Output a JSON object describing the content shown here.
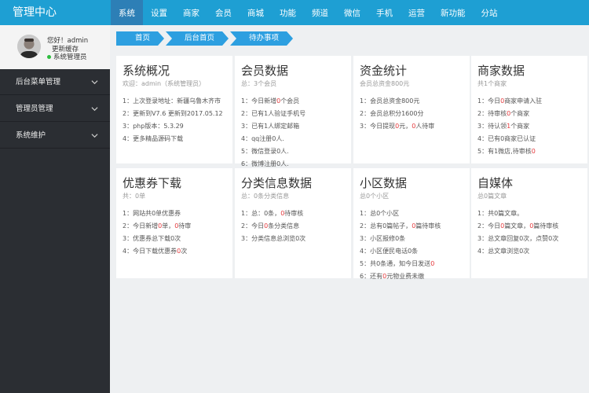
{
  "brand": "管理中心",
  "nav": [
    "系统",
    "设置",
    "商家",
    "会员",
    "商城",
    "功能",
    "频道",
    "微信",
    "手机",
    "运营",
    "新功能",
    "分站"
  ],
  "user": {
    "greeting": "您好！admin",
    "refresh_cache": "更新缓存",
    "role": "系统管理员"
  },
  "sidebar": {
    "items": [
      {
        "label": "后台菜单管理"
      },
      {
        "label": "管理员管理"
      },
      {
        "label": "系统维护"
      }
    ]
  },
  "breadcrumb": [
    "首页",
    "后台首页",
    "待办事项"
  ],
  "cards": [
    {
      "title": "系统概况",
      "subtitle": "欢迎：admin（系统管理员）",
      "lines": [
        [
          {
            "t": "1：上次登录地址：新疆乌鲁木齐市"
          }
        ],
        [
          {
            "t": "2：更新到V7.6 更新到2017.05.12"
          }
        ],
        [
          {
            "t": "3：php版本：5.3.29"
          }
        ],
        [
          {
            "t": "4：更多精品源码下载"
          }
        ]
      ]
    },
    {
      "title": "会员数据",
      "subtitle": "总：3个会员",
      "lines": [
        [
          {
            "t": "1：今日新增"
          },
          {
            "t": "0",
            "r": true
          },
          {
            "t": "个会员"
          }
        ],
        [
          {
            "t": "2：已有1人验证手机号"
          }
        ],
        [
          {
            "t": "3：已有1人绑定邮箱"
          }
        ],
        [
          {
            "t": "4：qq注册0人."
          }
        ],
        [
          {
            "t": "5：微信登录0人."
          }
        ],
        [
          {
            "t": "6：微博注册0人."
          }
        ]
      ]
    },
    {
      "title": "资金统计",
      "subtitle": "会员总资金800元",
      "lines": [
        [
          {
            "t": "1：会员总资金800元"
          }
        ],
        [
          {
            "t": "2：会员总积分1600分"
          }
        ],
        [
          {
            "t": "3：今日提现"
          },
          {
            "t": "0",
            "r": true
          },
          {
            "t": "元，"
          },
          {
            "t": "0",
            "r": true
          },
          {
            "t": "人待审"
          }
        ]
      ]
    },
    {
      "title": "商家数据",
      "subtitle": "共1个商家",
      "lines": [
        [
          {
            "t": "1：今日"
          },
          {
            "t": "0",
            "r": true
          },
          {
            "t": "商家申请入驻"
          }
        ],
        [
          {
            "t": "2：待审核"
          },
          {
            "t": "0",
            "r": true
          },
          {
            "t": "个商家"
          }
        ],
        [
          {
            "t": "3：待认领"
          },
          {
            "t": "1",
            "r": true
          },
          {
            "t": "个商家"
          }
        ],
        [
          {
            "t": "4：已有0商家已认证"
          }
        ],
        [
          {
            "t": "5：有1微店,待审核"
          },
          {
            "t": "0",
            "r": true
          }
        ]
      ]
    },
    {
      "title": "优惠券下载",
      "subtitle": "共：0单",
      "lines": [
        [
          {
            "t": "1：网站共0单优惠券"
          }
        ],
        [
          {
            "t": "2：今日新增"
          },
          {
            "t": "0",
            "r": true
          },
          {
            "t": "单，"
          },
          {
            "t": "0",
            "r": true
          },
          {
            "t": "待审"
          }
        ],
        [
          {
            "t": "3：优惠券总下载0次"
          }
        ],
        [
          {
            "t": "4：今日下载优惠券"
          },
          {
            "t": "0",
            "r": true
          },
          {
            "t": "次"
          }
        ]
      ]
    },
    {
      "title": "分类信息数据",
      "subtitle": "总：0条分类信息",
      "lines": [
        [
          {
            "t": "1：总：0条，"
          },
          {
            "t": "0",
            "r": true
          },
          {
            "t": "待审核"
          }
        ],
        [
          {
            "t": "2：今日"
          },
          {
            "t": "0",
            "r": true
          },
          {
            "t": "条分类信息"
          }
        ],
        [
          {
            "t": "3：分类信息总浏览0次"
          }
        ]
      ]
    },
    {
      "title": "小区数据",
      "subtitle": "总0个小区",
      "lines": [
        [
          {
            "t": "1：总0个小区"
          }
        ],
        [
          {
            "t": "2：总有0篇帖子，"
          },
          {
            "t": "0",
            "r": true
          },
          {
            "t": "篇待审核"
          }
        ],
        [
          {
            "t": "3：小区报修0条"
          }
        ],
        [
          {
            "t": "4：小区便民电话0条"
          }
        ],
        [
          {
            "t": "5：共0条通，知今日发送"
          },
          {
            "t": "0",
            "r": true
          }
        ],
        [
          {
            "t": "6：还有"
          },
          {
            "t": "0",
            "r": true
          },
          {
            "t": "元物业费未缴"
          }
        ]
      ]
    },
    {
      "title": "自媒体",
      "subtitle": "总0篇文章",
      "lines": [
        [
          {
            "t": "1：共0篇文章。"
          }
        ],
        [
          {
            "t": "2：今日"
          },
          {
            "t": "0",
            "r": true
          },
          {
            "t": "篇文章，"
          },
          {
            "t": "0",
            "r": true
          },
          {
            "t": "篇待审核"
          }
        ],
        [
          {
            "t": "3：总文章回复0次，点赞0次"
          }
        ],
        [
          {
            "t": "4：总文章浏览0次"
          }
        ]
      ]
    }
  ],
  "colors": {
    "topbar": "#1e9fd3",
    "nav_active": "#2d7fb6",
    "sidebar": "#2b2e33",
    "breadcrumb": "#2d9fe0",
    "highlight": "#e4393c"
  }
}
